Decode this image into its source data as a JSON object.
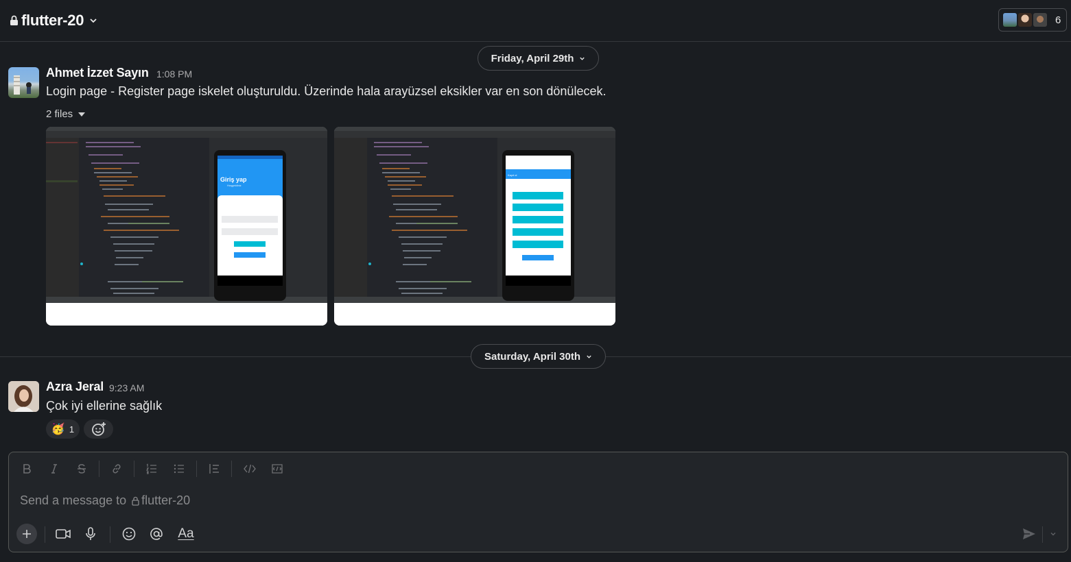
{
  "header": {
    "channel_name": "flutter-20",
    "member_count": "6"
  },
  "dividers": [
    {
      "label": "Friday, April 29th"
    },
    {
      "label": "Saturday, April 30th"
    }
  ],
  "messages": [
    {
      "sender": "Ahmet İzzet Sayın",
      "time": "1:08 PM",
      "text": "Login page - Register page iskelet oluşturuldu. Üzerinde hala arayüzsel eksikler var en son dönülecek.",
      "files_label": "2 files",
      "files": [
        {
          "screen_title": "Giriş yap",
          "screen_subtitle": "Hoşgeldiniz"
        },
        {
          "screen_title": "Kayıt ol",
          "screen_subtitle": ""
        }
      ]
    },
    {
      "sender": "Azra Jeral",
      "time": "9:23 AM",
      "text": "Çok iyi ellerine sağlık",
      "reactions": [
        {
          "emoji": "🥳",
          "count": "1"
        }
      ]
    }
  ],
  "composer": {
    "placeholder_prefix": "Send a message to",
    "placeholder_channel": "flutter-20",
    "format_label": "Aa"
  },
  "colors": {
    "background": "#1a1d21",
    "border": "#35373b",
    "text": "#e8e8e8",
    "muted": "#ababad",
    "composer_bg": "#222529"
  }
}
